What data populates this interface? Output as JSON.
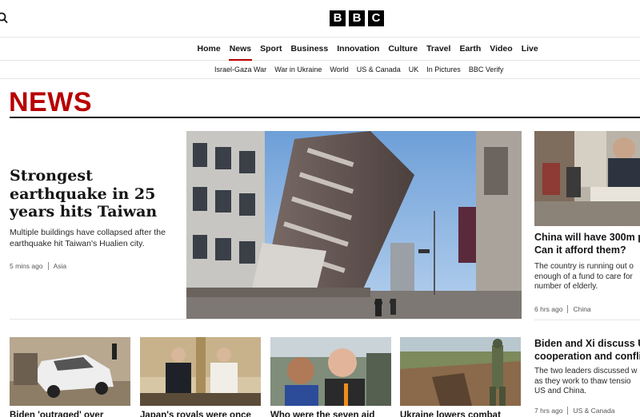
{
  "header": {
    "logo_letters": [
      "B",
      "B",
      "C"
    ],
    "search_icon": "search-icon"
  },
  "main_nav": {
    "items": [
      "Home",
      "News",
      "Sport",
      "Business",
      "Innovation",
      "Culture",
      "Travel",
      "Earth",
      "Video",
      "Live"
    ],
    "active": "News"
  },
  "sub_nav": {
    "items": [
      "Israel-Gaza War",
      "War in Ukraine",
      "World",
      "US & Canada",
      "UK",
      "In Pictures",
      "BBC Verify"
    ]
  },
  "section": {
    "title": "NEWS",
    "accent_color": "#b80000"
  },
  "lead": {
    "headline": "Strongest earthquake in 25 years hits Taiwan",
    "summary": "Multiple buildings have collapsed after the earthquake hit Taiwan's Hualien city.",
    "time": "5 mins ago",
    "tag": "Asia"
  },
  "right_story": {
    "headline_line1": "China will have 300m p",
    "headline_line2": "Can it afford them?",
    "summary_line1": "The country is running out o",
    "summary_line2": "enough of a fund to care for",
    "summary_line3": "number of elderly.",
    "time": "6 hrs ago",
    "tag": "China"
  },
  "right_story_2": {
    "headline_line1": "Biden and Xi discuss U",
    "headline_line2": "cooperation and confli",
    "summary_line1": "The two leaders discussed w",
    "summary_line2": "as they work to thaw tensio",
    "summary_line3": "US and China.",
    "time": "7 hrs ago",
    "tag": "US & Canada"
  },
  "cards": [
    {
      "title": "Biden 'outraged' over"
    },
    {
      "title": "Japan's royals were once"
    },
    {
      "title": "Who were the seven aid"
    },
    {
      "title": "Ukraine lowers combat"
    }
  ]
}
